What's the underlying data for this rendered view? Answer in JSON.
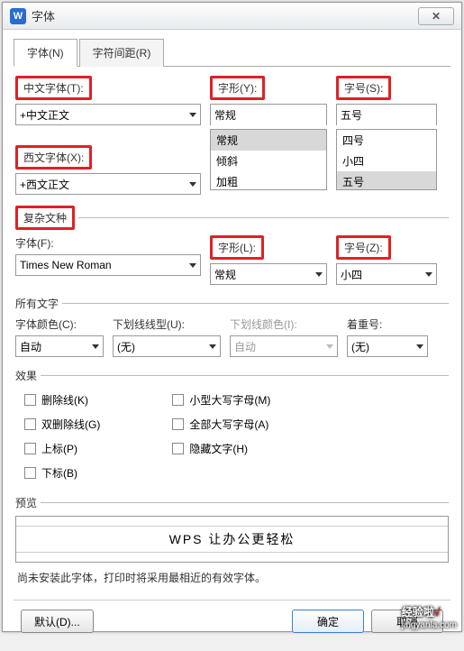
{
  "window": {
    "title": "字体",
    "close": "✕",
    "app_icon": "W"
  },
  "tabs": {
    "font": "字体(N)",
    "spacing": "字符间距(R)"
  },
  "chinese": {
    "label": "中文字体(T):",
    "selected": "+中文正文"
  },
  "style": {
    "label": "字形(Y):",
    "selected": "常规",
    "options": [
      "常规",
      "倾斜",
      "加粗"
    ]
  },
  "size": {
    "label": "字号(S):",
    "selected": "五号",
    "options": [
      "四号",
      "小四",
      "五号"
    ]
  },
  "western": {
    "label": "西文字体(X):",
    "selected": "+西文正文"
  },
  "complex": {
    "section": "复杂文种",
    "font_label": "字体(F):",
    "font_selected": "Times New Roman",
    "style_label": "字形(L):",
    "style_selected": "常规",
    "size_label": "字号(Z):",
    "size_selected": "小四"
  },
  "alltext": {
    "section": "所有文字",
    "color_label": "字体颜色(C):",
    "color_value": "自动",
    "underline_label": "下划线线型(U):",
    "underline_value": "(无)",
    "ucolor_label": "下划线颜色(I):",
    "ucolor_value": "自动",
    "emphasis_label": "着重号:",
    "emphasis_value": "(无)"
  },
  "effects": {
    "section": "效果",
    "strike": "删除线(K)",
    "dstrike": "双删除线(G)",
    "sup": "上标(P)",
    "sub": "下标(B)",
    "smallcaps": "小型大写字母(M)",
    "allcaps": "全部大写字母(A)",
    "hidden": "隐藏文字(H)"
  },
  "preview": {
    "section": "预览",
    "text": "WPS 让办公更轻松",
    "note": "尚未安装此字体，打印时将采用最相近的有效字体。"
  },
  "footer": {
    "default": "默认(D)...",
    "ok": "确定",
    "cancel": "取消"
  },
  "watermark": {
    "main": "经验啦",
    "check": "√",
    "sub": "jingyanla.com"
  }
}
